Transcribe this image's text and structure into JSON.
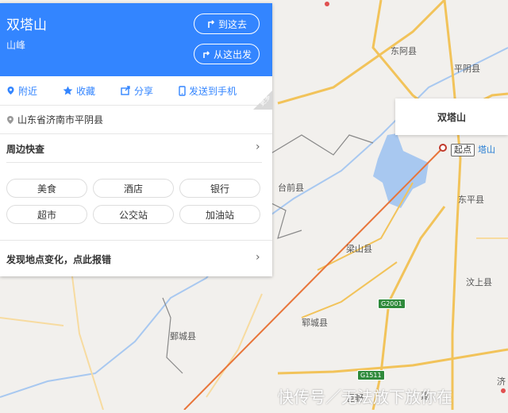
{
  "place": {
    "name": "双塔山",
    "category": "山峰",
    "address": "山东省济南市平阴县"
  },
  "header_buttons": {
    "go_here": "到这去",
    "from_here": "从这出发"
  },
  "actions": [
    "附近",
    "收藏",
    "分享",
    "发送到手机"
  ],
  "corner_badge": "更多",
  "nearby": {
    "title": "周边快查",
    "chips": [
      "美食",
      "酒店",
      "银行",
      "超市",
      "公交站",
      "加油站"
    ]
  },
  "report": {
    "label": "发现地点变化，点此报错"
  },
  "map": {
    "tooltip_title": "双塔山",
    "start_label": "起点",
    "poi_label_partial": "塔山",
    "labels": {
      "donga": "东阿县",
      "pingyin": "平阴县",
      "taiqian": "台前县",
      "dongping": "东平县",
      "liangshan": "梁山县",
      "wenshang": "汶上县",
      "yuncheng": "郓城县",
      "juancheng": "鄄城县",
      "juye": "巨野",
      "jia": "嘉",
      "ji": "济"
    },
    "shields": [
      "G2001",
      "G1511"
    ],
    "colors": {
      "route": "#e8753a",
      "panel_header": "#3385ff",
      "water": "#a8c8f0",
      "highway": "#f2c35a"
    }
  },
  "watermark": "快传号／无法放下放你在"
}
